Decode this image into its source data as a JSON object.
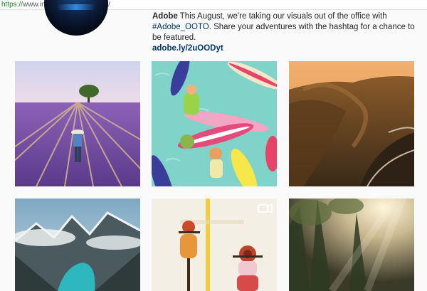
{
  "browser": {
    "url_scheme": "https://",
    "url_rest": "www.instagram.com/adobe/"
  },
  "profile": {
    "name": "Adobe",
    "bio_part1": " This August, we're taking our visuals out of the office with ",
    "hashtag": "#Adobe_OOTO",
    "bio_part2": ". Share your adventures with the hashtag for a chance to be featured.",
    "link": "adobe.ly/2uOODyt"
  },
  "posts": [
    {
      "subject": "lavender field with tree"
    },
    {
      "subject": "beach illustration with surfboards"
    },
    {
      "subject": "sunset mountain valley road"
    },
    {
      "subject": "mountain lake in clouds"
    },
    {
      "subject": "illustrated cyclists",
      "icon": "video-icon"
    },
    {
      "subject": "sunlit forest"
    }
  ],
  "colors": {
    "link": "#003569",
    "url_scheme": "#1a8a1a",
    "background": "#fafafa"
  }
}
